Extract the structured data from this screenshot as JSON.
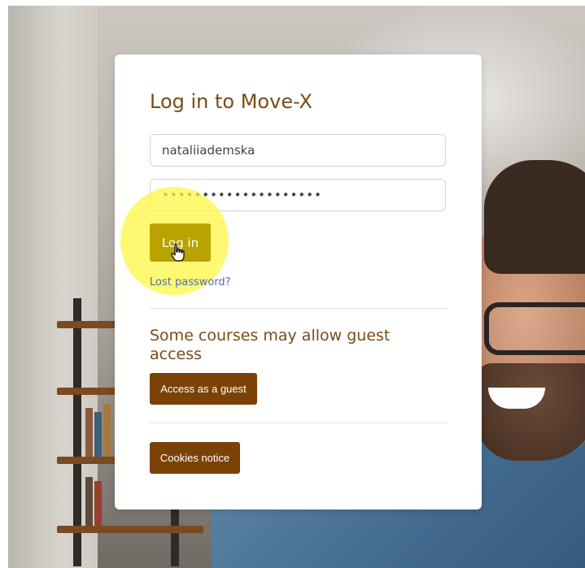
{
  "login": {
    "title": "Log in to Move-X",
    "username_value": "nataliiademska",
    "password_value": "••••••••••••••••••••",
    "login_button": "Log in",
    "lost_password": "Lost password?"
  },
  "guest": {
    "heading": "Some courses may allow guest access",
    "button": "Access as a guest"
  },
  "cookies": {
    "button": "Cookies notice"
  },
  "colors": {
    "accent_brown": "#7b4208",
    "heading_brown": "#7a4b16",
    "login_button": "#b9a300",
    "click_highlight": "#fff53c",
    "link_blue": "#4f6fa8"
  },
  "icons": [
    "hand-pointer-cursor-icon"
  ]
}
